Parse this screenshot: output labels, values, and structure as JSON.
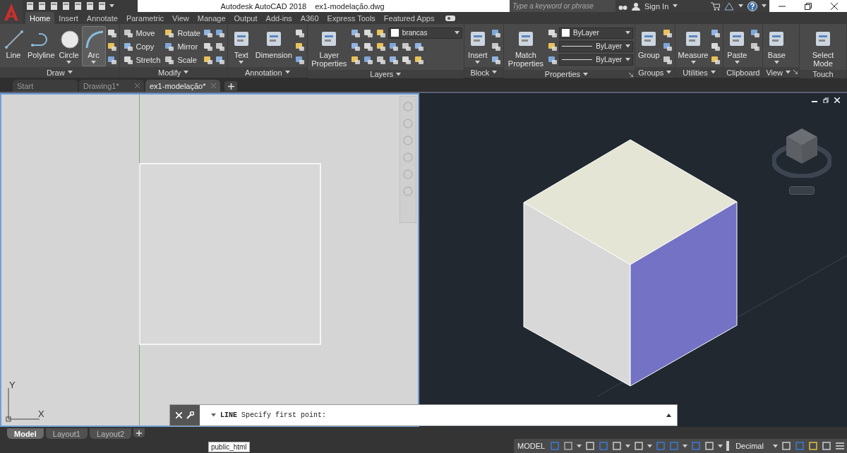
{
  "title_bar": {
    "app": "Autodesk AutoCAD 2018",
    "file": "ex1-modelação.dwg",
    "search": {
      "placeholder": "Type a keyword or phrase"
    },
    "sign_in": "Sign In"
  },
  "ribbon_tabs": [
    {
      "label": "Home",
      "selected": true
    },
    {
      "label": "Insert",
      "selected": false
    },
    {
      "label": "Annotate",
      "selected": false
    },
    {
      "label": "Parametric",
      "selected": false
    },
    {
      "label": "View",
      "selected": false
    },
    {
      "label": "Manage",
      "selected": false
    },
    {
      "label": "Output",
      "selected": false
    },
    {
      "label": "Add-ins",
      "selected": false
    },
    {
      "label": "A360",
      "selected": false
    },
    {
      "label": "Express Tools",
      "selected": false
    },
    {
      "label": "Featured Apps",
      "selected": false
    }
  ],
  "panels": [
    {
      "title": "Draw",
      "menu": true,
      "launcher": false,
      "tools": [
        {
          "kind": "large",
          "label": "Line",
          "selected": false,
          "dropdown": false
        },
        {
          "kind": "large",
          "label": "Polyline",
          "selected": false,
          "dropdown": false
        },
        {
          "kind": "large",
          "label": "Circle",
          "selected": false,
          "dropdown": true
        },
        {
          "kind": "large",
          "label": "Arc",
          "selected": true,
          "dropdown": true
        },
        {
          "kind": "stack",
          "items": [
            {
              "kind": "icon"
            },
            {
              "kind": "icon"
            },
            {
              "kind": "icon"
            }
          ]
        }
      ]
    },
    {
      "title": "Modify",
      "menu": true,
      "launcher": false,
      "tools": [
        {
          "kind": "stack",
          "items": [
            {
              "kind": "small",
              "label": "Move"
            },
            {
              "kind": "small",
              "label": "Copy"
            },
            {
              "kind": "small",
              "label": "Stretch"
            }
          ]
        },
        {
          "kind": "stack",
          "items": [
            {
              "kind": "small",
              "label": "Rotate"
            },
            {
              "kind": "small",
              "label": "Mirror"
            },
            {
              "kind": "small",
              "label": "Scale"
            }
          ]
        },
        {
          "kind": "stack",
          "items": [
            {
              "kind": "icon"
            },
            {
              "kind": "icon"
            },
            {
              "kind": "icon"
            }
          ]
        },
        {
          "kind": "stack",
          "items": [
            {
              "kind": "icon"
            },
            {
              "kind": "icon"
            },
            {
              "kind": "icon"
            }
          ]
        }
      ]
    },
    {
      "title": "Annotation",
      "menu": true,
      "launcher": false,
      "tools": [
        {
          "kind": "large",
          "label": "Text",
          "selected": false,
          "dropdown": true
        },
        {
          "kind": "large",
          "label": "Dimension",
          "selected": false,
          "dropdown": false
        },
        {
          "kind": "stack",
          "items": [
            {
              "kind": "icon"
            },
            {
              "kind": "icon"
            },
            {
              "kind": "icon"
            }
          ]
        }
      ]
    },
    {
      "title": "Layers",
      "menu": true,
      "launcher": false,
      "tools": [
        {
          "kind": "large",
          "label": "Layer Properties",
          "selected": false,
          "dropdown": false
        },
        {
          "kind": "stack",
          "items": [
            {
              "kind": "row",
              "items": [
                {
                  "kind": "icon"
                },
                {
                  "kind": "icon"
                },
                {
                  "kind": "icon"
                },
                {
                  "kind": "dropdown",
                  "value": "brancas"
                }
              ]
            },
            {
              "kind": "row",
              "items": [
                {
                  "kind": "icon"
                },
                {
                  "kind": "icon"
                },
                {
                  "kind": "icon"
                },
                {
                  "kind": "icon"
                },
                {
                  "kind": "icon"
                },
                {
                  "kind": "icon"
                }
              ]
            },
            {
              "kind": "row",
              "items": [
                {
                  "kind": "icon"
                },
                {
                  "kind": "icon"
                },
                {
                  "kind": "icon"
                },
                {
                  "kind": "icon"
                },
                {
                  "kind": "icon"
                },
                {
                  "kind": "icon"
                }
              ]
            }
          ]
        }
      ]
    },
    {
      "title": "Block",
      "menu": true,
      "launcher": false,
      "tools": [
        {
          "kind": "large",
          "label": "Insert",
          "selected": false,
          "dropdown": true
        },
        {
          "kind": "stack",
          "items": [
            {
              "kind": "icon"
            },
            {
              "kind": "icon"
            },
            {
              "kind": "icon"
            }
          ]
        }
      ]
    },
    {
      "title": "Properties",
      "menu": true,
      "launcher": true,
      "tools": [
        {
          "kind": "large",
          "label": "Match Properties",
          "selected": false,
          "dropdown": false
        },
        {
          "kind": "stack",
          "items": [
            {
              "kind": "icon"
            },
            {
              "kind": "icon"
            },
            {
              "kind": "icon"
            }
          ]
        },
        {
          "kind": "stack",
          "items": [
            {
              "kind": "dropdown",
              "value": "ByLayer"
            },
            {
              "kind": "dropdown",
              "value": "ByLayer"
            },
            {
              "kind": "dropdown",
              "value": "ByLayer"
            }
          ]
        }
      ]
    },
    {
      "title": "Groups",
      "menu": true,
      "launcher": false,
      "tools": [
        {
          "kind": "large",
          "label": "Group",
          "selected": false,
          "dropdown": false
        },
        {
          "kind": "stack",
          "items": [
            {
              "kind": "icon"
            },
            {
              "kind": "icon"
            },
            {
              "kind": "icon"
            }
          ]
        }
      ]
    },
    {
      "title": "Utilities",
      "menu": true,
      "launcher": false,
      "tools": [
        {
          "kind": "large",
          "label": "Measure",
          "selected": false,
          "dropdown": true
        },
        {
          "kind": "stack",
          "items": [
            {
              "kind": "icon"
            },
            {
              "kind": "icon"
            },
            {
              "kind": "icon"
            }
          ]
        }
      ]
    },
    {
      "title": "Clipboard",
      "menu": false,
      "launcher": false,
      "tools": [
        {
          "kind": "large",
          "label": "Paste",
          "selected": false,
          "dropdown": true
        },
        {
          "kind": "stack",
          "items": [
            {
              "kind": "icon"
            },
            {
              "kind": "icon"
            }
          ]
        }
      ]
    },
    {
      "title": "View",
      "menu": true,
      "launcher": true,
      "tools": [
        {
          "kind": "large",
          "label": "Base",
          "selected": false,
          "dropdown": true
        }
      ]
    },
    {
      "title": "Touch",
      "menu": false,
      "launcher": false,
      "tools": [
        {
          "kind": "large",
          "label": "Select Mode",
          "selected": false,
          "dropdown": false
        }
      ]
    }
  ],
  "file_tabs": [
    {
      "label": "Start",
      "selected": false
    },
    {
      "label": "Drawing1*",
      "selected": false
    },
    {
      "label": "ex1-modelação*",
      "selected": true
    }
  ],
  "ucs": {
    "y": "Y",
    "x": "X"
  },
  "command_line": {
    "text": "**LINE** Specify first point:"
  },
  "layout_tabs": [
    {
      "label": "Model",
      "selected": true
    },
    {
      "label": "Layout1",
      "selected": false
    },
    {
      "label": "Layout2",
      "selected": false
    }
  ],
  "tooltip": "public_html",
  "status_bar": {
    "mode": "MODEL",
    "units": "Decimal"
  }
}
